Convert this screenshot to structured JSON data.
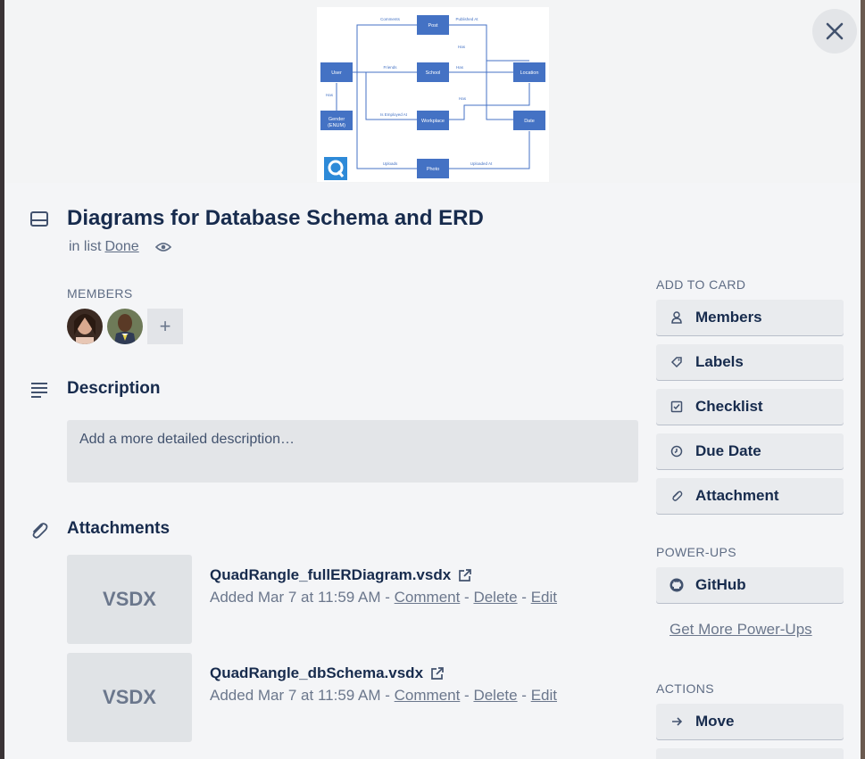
{
  "card": {
    "title": "Diagrams for Database Schema and ERD",
    "in_list_prefix": "in list",
    "list_name": "Done"
  },
  "cover": {
    "diagram": {
      "boxes": [
        "Post",
        "User",
        "School",
        "Location",
        "Gender\n(ENUM)",
        "Workplace",
        "Date",
        "Photo"
      ],
      "edge_labels": [
        "Comments",
        "Published At",
        "Has",
        "Friends",
        "Has",
        "Has",
        "Is Employed At",
        "Uploads",
        "Uploaded At",
        "Has"
      ]
    }
  },
  "members": {
    "label": "MEMBERS",
    "add_label": "+"
  },
  "description": {
    "title": "Description",
    "placeholder": "Add a more detailed description…"
  },
  "attachments": {
    "title": "Attachments",
    "items": [
      {
        "thumb": "VSDX",
        "name": "QuadRangle_fullERDiagram.vsdx",
        "added": "Added Mar 7 at 11:59 AM",
        "sep": " - ",
        "comment": "Comment",
        "delete": "Delete",
        "edit": "Edit"
      },
      {
        "thumb": "VSDX",
        "name": "QuadRangle_dbSchema.vsdx",
        "added": "Added Mar 7 at 11:59 AM",
        "sep": " - ",
        "comment": "Comment",
        "delete": "Delete",
        "edit": "Edit"
      }
    ]
  },
  "sidebar": {
    "add_to_card_label": "ADD TO CARD",
    "add_buttons": [
      {
        "label": "Members",
        "icon": "person-icon"
      },
      {
        "label": "Labels",
        "icon": "tag-icon"
      },
      {
        "label": "Checklist",
        "icon": "checkbox-icon"
      },
      {
        "label": "Due Date",
        "icon": "clock-icon"
      },
      {
        "label": "Attachment",
        "icon": "paperclip-icon"
      }
    ],
    "power_ups_label": "POWER-UPS",
    "power_ups": [
      {
        "label": "GitHub",
        "icon": "github-icon"
      }
    ],
    "more_power_ups": "Get More Power-Ups",
    "actions_label": "ACTIONS",
    "actions": [
      {
        "label": "Move",
        "icon": "arrow-right-icon"
      }
    ]
  },
  "colors": {
    "diagram_box": "#4472c4",
    "text_primary": "#172b4d",
    "text_muted": "#5e6c84",
    "button_bg": "#e9ebee"
  }
}
